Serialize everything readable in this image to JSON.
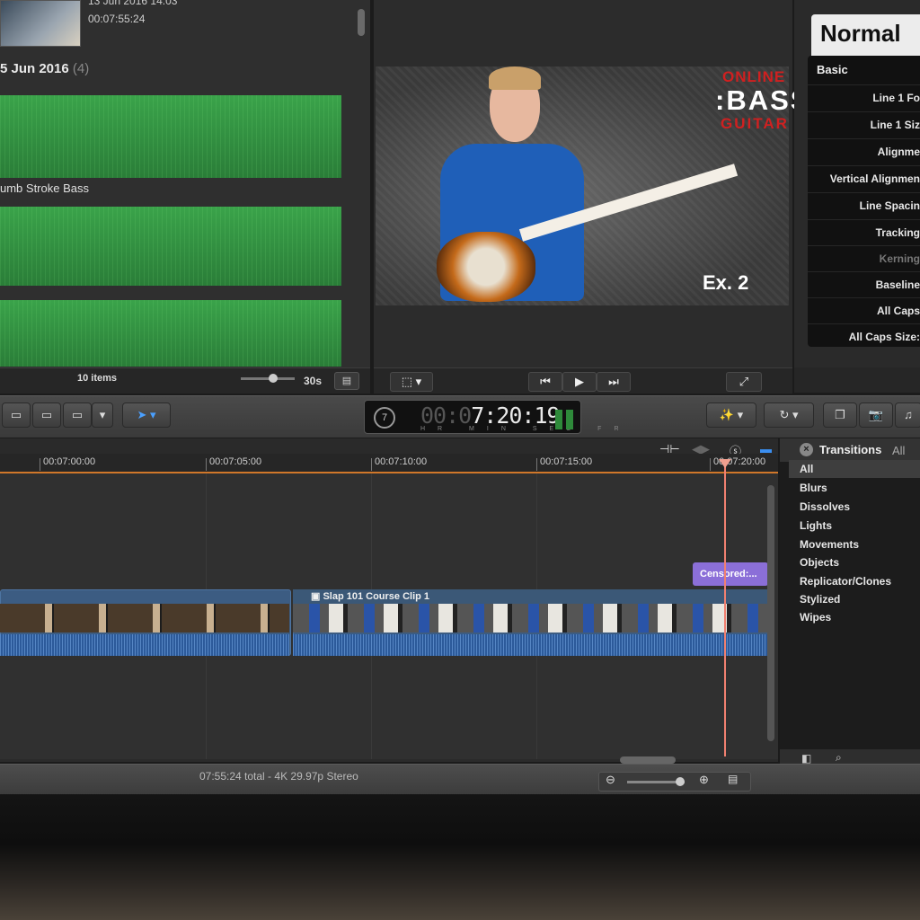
{
  "browser": {
    "top_clip": {
      "date": "13 Jun 2016 14:03",
      "duration": "00:07:55:24"
    },
    "date_group": "5 Jun 2016",
    "date_count": "(4)",
    "clip_name": "umb Stroke Bass",
    "items_label": "10 items",
    "duration_label": "30s"
  },
  "viewer": {
    "logo_online": "ONLINE",
    "logo_bass": ":BASS",
    "logo_guitar": "GUITAR",
    "overlay_text": "Ex. 2"
  },
  "inspector": {
    "title": "Normal",
    "section": "Basic",
    "rows": [
      "Line 1 Fo",
      "Line 1 Siz",
      "Alignme",
      "Vertical Alignmen",
      "Line Spacin",
      "Tracking",
      "Kerning",
      "Baseline",
      "All Caps",
      "All Caps Size:"
    ]
  },
  "toolbar": {
    "timecode_dim": "00:0",
    "timecode": "7:20:19",
    "timecode_units": "HR MIN SEC FR",
    "timecode_icon": "7"
  },
  "timeline": {
    "ruler": [
      "00:07:00:00",
      "00:07:05:00",
      "00:07:10:00",
      "00:07:15:00",
      "00:07:20:00"
    ],
    "clip_title": "Slap 101 Course Clip 1",
    "title_clip": "Censored:...",
    "status": "07:55:24 total - 4K 29.97p Stereo"
  },
  "transitions": {
    "title": "Transitions",
    "filter": "All",
    "items": [
      "All",
      "Blurs",
      "Dissolves",
      "Lights",
      "Movements",
      "Objects",
      "Replicator/Clones",
      "Stylized",
      "Wipes"
    ],
    "selected": "All"
  },
  "colors": {
    "accent_orange": "#d0772a",
    "playhead": "#f08070",
    "title_clip": "#8b6fd8",
    "video_clip": "#3c5c82"
  }
}
